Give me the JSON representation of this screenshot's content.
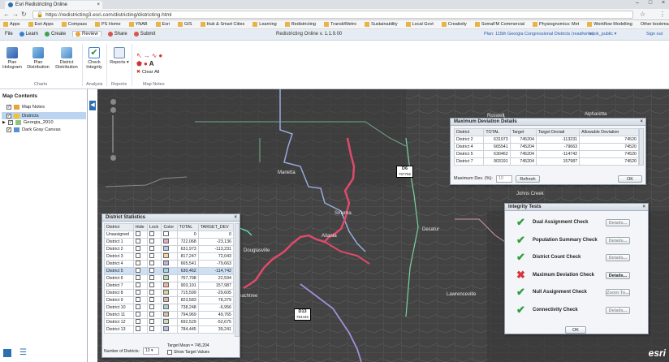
{
  "browser": {
    "tab_title": "Esri Redistricting Online",
    "url": "https://redistricting3.esri.com/districting/districting.html",
    "bookmarks": [
      "Apps",
      "Esri Apps",
      "Compass",
      "PS Home",
      "YNAB",
      "Esri",
      "GIS",
      "Hub & Smart Cities",
      "Learning",
      "Redistricting",
      "Transit/Metro",
      "Sustainability",
      "Local Govt",
      "Creativity",
      "SomaFM Commercial",
      "Physiognomics: Met",
      "Workflow Modelling"
    ],
    "other_bookmarks": "Other bookmarks"
  },
  "header": {
    "tabs": [
      {
        "label": "File",
        "color": ""
      },
      {
        "label": "Learn",
        "color": "#3b7fd1"
      },
      {
        "label": "Create",
        "color": "#3fa34d"
      },
      {
        "label": "Review",
        "color": "#e8a33a"
      },
      {
        "label": "Share",
        "color": "#d9534f"
      },
      {
        "label": "Submit",
        "color": "#d9534f"
      }
    ],
    "app_title": "Redistricting Online  v. 1.1.9.00",
    "plan": "Plan: 115th Georgia Congressional Districts (read/write)",
    "user": "esok_public",
    "sign_out": "Sign out"
  },
  "ribbon": {
    "plan_hologram": "Plan Hologram",
    "plan_distribution": "Plan Distribution",
    "district_distribution": "District Distribution",
    "check_integrity": "Check Integrity",
    "reports": "Reports",
    "clear_all": "Clear All",
    "groups": {
      "charts": "Charts",
      "analysis": "Analysis",
      "reports": "Reports",
      "map_notes": "Map Notes"
    }
  },
  "sidebar": {
    "title": "Map Contents",
    "layers": [
      {
        "label": "Map Notes",
        "checked": true
      },
      {
        "label": "Districts",
        "checked": true
      },
      {
        "label": "Georgia_2010",
        "checked": true
      },
      {
        "label": "Dark Gray Canvas",
        "checked": true
      }
    ]
  },
  "map": {
    "labels": [
      {
        "id": "D6",
        "value": "767756"
      },
      {
        "id": "D13",
        "value": "784445"
      }
    ],
    "cities": [
      "Marietta",
      "Atlanta",
      "Douglasville",
      "Smyrna",
      "Johns Creek",
      "Peachtree",
      "Roswell",
      "Alpharetta",
      "Decatur",
      "Lawrenceville"
    ]
  },
  "max_dev": {
    "title": "Maximum Deviation Details",
    "columns": [
      "District",
      "TOTAL",
      "Target",
      "Target Deviati",
      "Allowable Deviation"
    ],
    "rows": [
      [
        "District 2",
        "631973",
        "745204",
        "-113231",
        "74520"
      ],
      [
        "District 4",
        "665541",
        "745204",
        "-79663",
        "74520"
      ],
      [
        "District 5",
        "630462",
        "745204",
        "-114742",
        "74520"
      ],
      [
        "District 7",
        "903191",
        "745204",
        "157987",
        "74520"
      ]
    ],
    "max_label": "Maximum Dev. (%):",
    "max_value": "10",
    "refresh": "Refresh",
    "ok": "OK"
  },
  "district_stats": {
    "title": "District Statistics",
    "columns": [
      "District",
      "Hide",
      "Lock",
      "Color",
      "TOTAL",
      "TARGET_DEV"
    ],
    "rows": [
      [
        "Unassigned",
        "0",
        "0"
      ],
      [
        "District 1",
        "722,068",
        "-23,136"
      ],
      [
        "District 2",
        "631,973",
        "-113,231"
      ],
      [
        "District 3",
        "817,247",
        "72,043"
      ],
      [
        "District 4",
        "665,541",
        "-79,663"
      ],
      [
        "District 5",
        "630,462",
        "-114,742"
      ],
      [
        "District 6",
        "767,798",
        "22,594"
      ],
      [
        "District 7",
        "903,191",
        "157,987"
      ],
      [
        "District 8",
        "715,599",
        "-29,605"
      ],
      [
        "District 9",
        "823,583",
        "78,379"
      ],
      [
        "District 10",
        "738,248",
        "-6,956"
      ],
      [
        "District 11",
        "794,969",
        "49,765"
      ],
      [
        "District 12",
        "692,529",
        "-52,675"
      ],
      [
        "District 13",
        "784,445",
        "39,241"
      ]
    ],
    "colors": [
      "#ffffff",
      "#e7a7c7",
      "#b9c9e8",
      "#f2d89a",
      "#c9b2e0",
      "#a3d5e8",
      "#b6dfae",
      "#f5b7a0",
      "#d6d6a0",
      "#e5b3b3",
      "#a8cfd8",
      "#d4c2a8",
      "#c6e0c0",
      "#bcbce8"
    ],
    "num_districts_label": "Number of Districts:",
    "num_districts": "13",
    "target_mean": "Target Mean = 745,204",
    "show_target": "Show Target Values"
  },
  "integrity": {
    "title": "Integrity Tests",
    "checks": [
      {
        "label": "Dual Assignment Check",
        "status": "pass",
        "button": "Details...",
        "enabled": false
      },
      {
        "label": "Population Summary Check",
        "status": "pass",
        "button": "Details...",
        "enabled": false
      },
      {
        "label": "District Count Check",
        "status": "pass",
        "button": "Details...",
        "enabled": false
      },
      {
        "label": "Maximum Deviation Check",
        "status": "fail",
        "button": "Details...",
        "enabled": true
      },
      {
        "label": "Null Assignment Check",
        "status": "pass",
        "button": "Zoom To...",
        "enabled": false
      },
      {
        "label": "Connectivity Check",
        "status": "pass",
        "button": "Details...",
        "enabled": false
      }
    ],
    "ok": "OK"
  },
  "brand": "esri"
}
